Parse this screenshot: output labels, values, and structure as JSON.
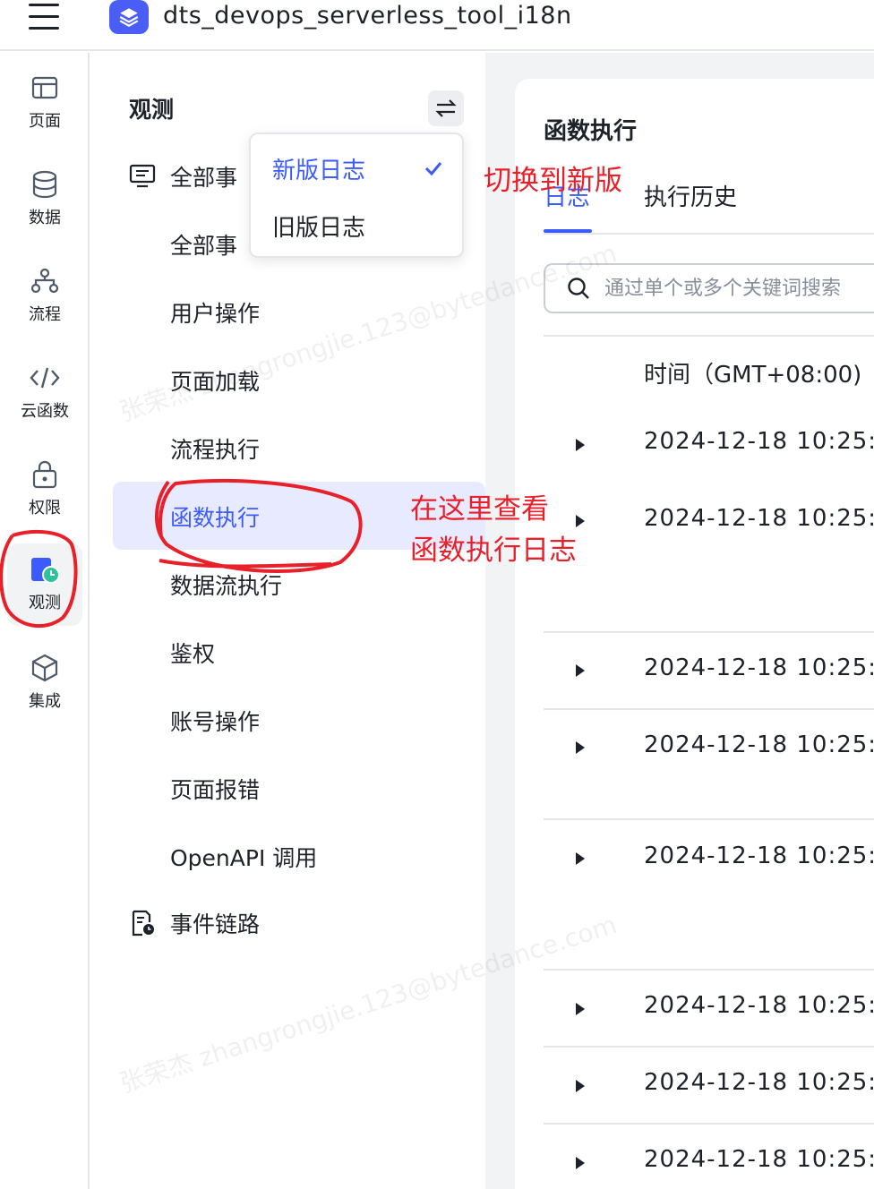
{
  "header": {
    "app_name": "dts_devops_serverless_tool_i18n"
  },
  "rail": {
    "items": [
      {
        "label": "页面",
        "icon": "page-icon"
      },
      {
        "label": "数据",
        "icon": "database-icon"
      },
      {
        "label": "流程",
        "icon": "flow-icon"
      },
      {
        "label": "云函数",
        "icon": "code-icon"
      },
      {
        "label": "权限",
        "icon": "lock-icon"
      },
      {
        "label": "观测",
        "icon": "observe-icon",
        "active": true
      },
      {
        "label": "集成",
        "icon": "cube-icon"
      }
    ]
  },
  "subnav": {
    "title": "观测",
    "group_all_events": "全部事",
    "items": [
      "全部事",
      "用户操作",
      "页面加载",
      "流程执行",
      "函数执行",
      "数据流执行",
      "鉴权",
      "账号操作",
      "页面报错",
      "OpenAPI 调用"
    ],
    "active_item": "函数执行",
    "group_event_chain": "事件链路"
  },
  "dropdown": {
    "options": [
      "新版日志",
      "旧版日志"
    ],
    "selected": "新版日志"
  },
  "panel": {
    "title": "函数执行",
    "tabs": [
      "日志",
      "执行历史"
    ],
    "active_tab": "日志",
    "search_placeholder": "通过单个或多个关键词搜索",
    "column_time": "时间（GMT+08:00)",
    "rows": [
      "2024-12-18 10:25:",
      "2024-12-18 10:25:",
      "2024-12-18 10:25:",
      "2024-12-18 10:25:",
      "2024-12-18 10:25:",
      "2024-12-18 10:25:",
      "2024-12-18 10:25:",
      "2024-12-18 10:25:"
    ]
  },
  "annotations": {
    "switch_note": "切换到新版",
    "view_note_line1": "在这里查看",
    "view_note_line2": "函数执行日志",
    "color": "#e8202a"
  },
  "watermark": {
    "text": "张荣杰 zhangrongjie.123@bytedance.com"
  },
  "colors": {
    "accent": "#3b5bfe",
    "active_bg": "#e8ebff",
    "brand_logo": "#4a5df5"
  }
}
